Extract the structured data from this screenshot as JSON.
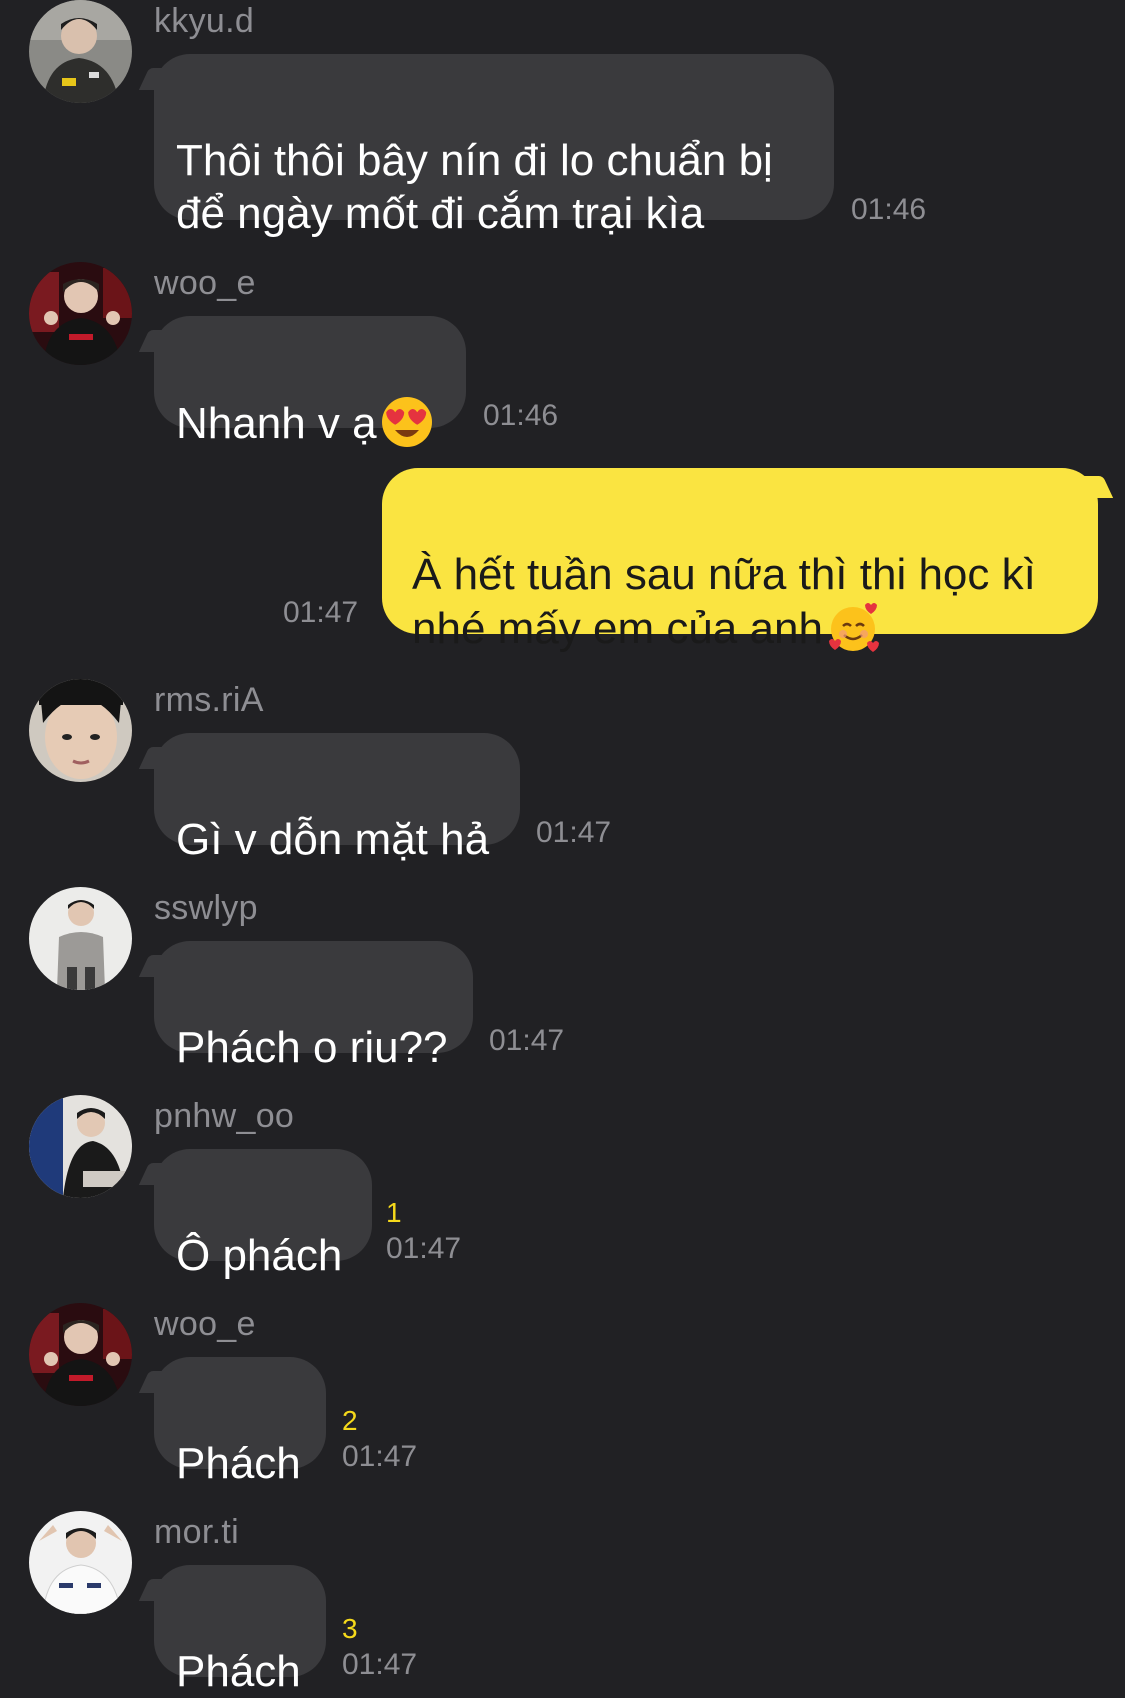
{
  "colors": {
    "background": "#212124",
    "incoming_bubble": "#3a3a3d",
    "outgoing_bubble": "#fae441",
    "meta_text": "#8e8e93",
    "unread_count": "#f5d91b"
  },
  "messages": [
    {
      "sender": "kkyu.d",
      "text": "Thôi thôi bây nín đi lo chuẩn bị\nđể ngày mốt đi cắm trại kìa",
      "time": "01:46",
      "avatar": "avatar-kkyu-d"
    },
    {
      "sender": "woo_e",
      "text": "Nhanh v ạ",
      "emoji": "heart-eyes-emoji",
      "time": "01:46",
      "avatar": "avatar-woo-e"
    },
    {
      "sender": "me",
      "text": "À hết tuần sau nữa thì thi học kì\nnhé mấy em của anh",
      "emoji": "smiling-face-with-hearts-emoji",
      "time": "01:47"
    },
    {
      "sender": "rms.riA",
      "text": "Gì v dỗn mặt hả",
      "time": "01:47",
      "avatar": "avatar-rms-ria"
    },
    {
      "sender": "sswlyp",
      "text": "Phách o riu??",
      "time": "01:47",
      "avatar": "avatar-sswlyp"
    },
    {
      "sender": "pnhw_oo",
      "text": "Ô phách",
      "unread": "1",
      "time": "01:47",
      "avatar": "avatar-pnhw-oo"
    },
    {
      "sender": "woo_e",
      "text": "Phách",
      "unread": "2",
      "time": "01:47",
      "avatar": "avatar-woo-e"
    },
    {
      "sender": "mor.ti",
      "text": "Phách",
      "unread": "3",
      "time": "01:47",
      "avatar": "avatar-mor-ti"
    }
  ]
}
